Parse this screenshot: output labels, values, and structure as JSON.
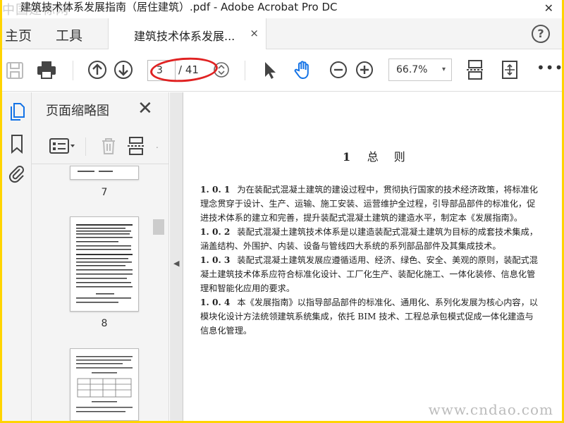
{
  "window": {
    "title": "建筑技术体系发展指南（居住建筑）.pdf - Adobe Acrobat Pro DC",
    "close_glyph": "✕",
    "watermark_top": "中国建标网"
  },
  "tabs": {
    "home": "主页",
    "tools": "工具",
    "document": "建筑技术体系发展...",
    "close_glyph": "×",
    "help_glyph": "?"
  },
  "toolbar": {
    "page_current": "3",
    "page_total": "/ 41",
    "zoom": "66.7%",
    "zoom_caret": "▾",
    "more": "•••",
    "annotation_color": "#e02222",
    "icons": [
      "save-icon",
      "print-icon",
      "prev-page-icon",
      "next-page-icon",
      "page-stepper-icon",
      "select-arrow-icon",
      "hand-icon",
      "zoom-out-icon",
      "zoom-in-icon",
      "fit-page-icon",
      "full-screen-icon",
      "more-icon"
    ]
  },
  "left_strip": {
    "icons": [
      "page-thumbnails-icon",
      "bookmark-icon",
      "attachment-icon"
    ]
  },
  "thumbnail_panel": {
    "title": "页面缩略图",
    "close_glyph": "✕",
    "pages": [
      {
        "label": "7"
      },
      {
        "label": "8"
      },
      {
        "label": ""
      }
    ],
    "collapse_glyph": "◀"
  },
  "document": {
    "chapter_number": "1",
    "chapter_title": "总则",
    "paragraphs": [
      {
        "num": "1. 0. 1",
        "lines": [
          "为在装配式混凝土建筑的建设过程中，贯彻执行国家的技术经济政策，将标准化",
          "理念贯穿于设计、生产、运输、施工安装、运营维护全过程，引导部品部件的标准化，促",
          "进技术体系的建立和完善，提升装配式混凝土建筑的建造水平，制定本《发展指南》。"
        ]
      },
      {
        "num": "1. 0. 2",
        "lines": [
          "装配式混凝土建筑技术体系是以建造装配式混凝土建筑为目标的成套技术集成，",
          "涵盖结构、外围护、内装、设备与管线四大系统的系列部品部件及其集成技术。"
        ]
      },
      {
        "num": "1. 0. 3",
        "lines": [
          "装配式混凝土建筑发展应遵循适用、经济、绿色、安全、美观的原则，装配式混",
          "凝土建筑技术体系应符合标准化设计、工厂化生产、装配化施工、一体化装修、信息化管",
          "理和智能化应用的要求。"
        ]
      },
      {
        "num": "1. 0. 4",
        "lines": [
          "本《发展指南》以指导部品部件的标准化、通用化、系列化发展为核心内容，以",
          "模块化设计方法统领建筑系统集成，依托 BIM 技术、工程总承包模式促成一体化建造与",
          "信息化管理。"
        ]
      }
    ]
  },
  "watermark_bottom": "www.cndao.com"
}
